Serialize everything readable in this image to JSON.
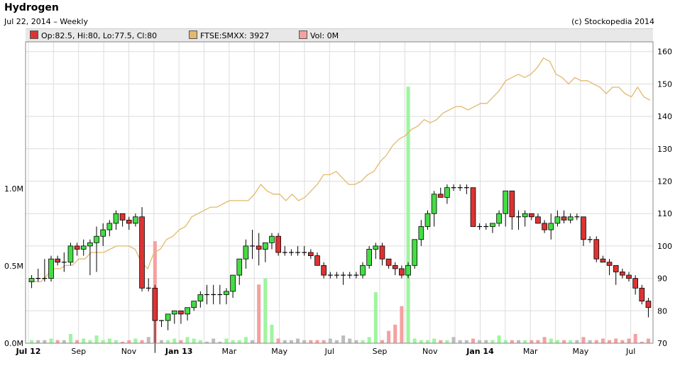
{
  "header": {
    "title": "Hydrogen",
    "subtitle": "Jul 22, 2014  –  Weekly",
    "copyright": "(c) Stockopedia 2014"
  },
  "legend": {
    "price": "Op:82.5, Hi:80, Lo:77.5, Cl:80",
    "index": "FTSE:SMXX: 3927",
    "volume": "Vol: 0M"
  },
  "colors": {
    "up": "#44dd44",
    "down": "#dd3333",
    "index_line": "#e2b96c",
    "vol_up": "#9ef59e",
    "vol_down": "#f5a0a0",
    "vol_neutral": "#bdbdbd",
    "grid": "#dddddd"
  },
  "chart_data": {
    "type": "candlestick",
    "x_labels": [
      "Jul 12",
      "Sep",
      "Nov",
      "Jan 13",
      "Mar",
      "May",
      "Jul",
      "Sep",
      "Nov",
      "Jan 14",
      "Mar",
      "May",
      "Jul"
    ],
    "x_label_bold": [
      true,
      false,
      false,
      true,
      false,
      false,
      false,
      false,
      false,
      true,
      false,
      false,
      false
    ],
    "price_axis": {
      "ticks": [
        70,
        80,
        90,
        100,
        110,
        120,
        130,
        140,
        150,
        160
      ],
      "range": [
        70,
        163
      ]
    },
    "volume_axis": {
      "ticks": [
        "0.0M",
        "0.5M",
        "1.0M"
      ],
      "tick_values": [
        0,
        0.5,
        1.0
      ],
      "range": [
        0,
        1.95
      ]
    },
    "candles": [
      [
        89,
        91,
        87,
        90
      ],
      [
        90,
        93,
        89,
        90
      ],
      [
        90,
        96,
        89,
        90
      ],
      [
        90,
        97,
        89,
        96
      ],
      [
        96,
        97,
        94,
        95
      ],
      [
        95,
        98,
        92,
        95
      ],
      [
        95,
        101,
        94,
        100
      ],
      [
        100,
        101,
        97,
        99
      ],
      [
        99,
        102,
        97,
        100
      ],
      [
        100,
        102,
        91,
        101
      ],
      [
        101,
        106,
        92,
        103
      ],
      [
        103,
        107,
        100,
        105
      ],
      [
        105,
        108,
        103,
        107
      ],
      [
        107,
        111,
        105,
        110
      ],
      [
        110,
        109,
        106,
        108
      ],
      [
        108,
        109,
        105,
        107
      ],
      [
        107,
        110,
        106,
        109
      ],
      [
        109,
        112,
        86,
        87
      ],
      [
        87,
        90,
        86,
        87
      ],
      [
        87,
        88,
        67,
        77
      ],
      [
        77,
        77,
        75,
        77
      ],
      [
        77,
        78,
        74,
        79
      ],
      [
        79,
        79,
        76,
        80
      ],
      [
        80,
        80,
        76,
        79
      ],
      [
        79,
        80,
        77,
        81
      ],
      [
        81,
        81,
        80,
        83
      ],
      [
        83,
        86,
        81,
        85
      ],
      [
        85,
        88,
        82,
        85
      ],
      [
        85,
        88,
        82,
        85
      ],
      [
        85,
        88,
        82,
        85
      ],
      [
        85,
        87,
        82,
        86
      ],
      [
        86,
        91,
        84,
        91
      ],
      [
        91,
        95,
        88,
        96
      ],
      [
        96,
        102,
        93,
        100
      ],
      [
        100,
        105,
        96,
        100
      ],
      [
        100,
        104,
        94,
        99
      ],
      [
        99,
        101,
        95,
        101
      ],
      [
        101,
        104,
        99,
        103
      ],
      [
        103,
        104,
        97,
        98
      ],
      [
        98,
        100,
        97,
        98
      ],
      [
        98,
        99,
        97,
        98
      ],
      [
        98,
        100,
        97,
        98
      ],
      [
        98,
        100,
        97,
        98
      ],
      [
        98,
        99,
        96,
        97
      ],
      [
        97,
        98,
        94,
        94
      ],
      [
        94,
        95,
        90,
        91
      ],
      [
        91,
        92,
        90,
        91
      ],
      [
        91,
        92,
        90,
        91
      ],
      [
        91,
        92,
        88,
        91
      ],
      [
        91,
        92,
        90,
        91
      ],
      [
        91,
        92,
        90,
        91
      ],
      [
        91,
        95,
        90,
        94
      ],
      [
        94,
        100,
        93,
        99
      ],
      [
        99,
        101,
        96,
        100
      ],
      [
        100,
        101,
        94,
        96
      ],
      [
        96,
        96,
        93,
        94
      ],
      [
        94,
        95,
        91,
        93
      ],
      [
        93,
        94,
        90,
        91
      ],
      [
        91,
        95,
        90,
        94
      ],
      [
        94,
        102,
        93,
        102
      ],
      [
        102,
        108,
        100,
        106
      ],
      [
        106,
        111,
        105,
        110
      ],
      [
        110,
        117,
        106,
        116
      ],
      [
        116,
        118,
        115,
        115
      ],
      [
        115,
        119,
        113,
        118
      ],
      [
        118,
        119,
        117,
        118
      ],
      [
        118,
        119,
        117,
        118
      ],
      [
        118,
        119,
        116,
        118
      ],
      [
        118,
        118,
        106,
        106
      ],
      [
        106,
        107,
        105,
        106
      ],
      [
        106,
        107,
        105,
        106
      ],
      [
        106,
        107,
        104,
        107
      ],
      [
        107,
        111,
        106,
        110
      ],
      [
        110,
        117,
        106,
        117
      ],
      [
        117,
        117,
        105,
        109
      ],
      [
        109,
        111,
        105,
        109
      ],
      [
        109,
        111,
        106,
        110
      ],
      [
        110,
        110,
        108,
        109
      ],
      [
        109,
        110,
        107,
        107
      ],
      [
        107,
        108,
        104,
        105
      ],
      [
        105,
        110,
        102,
        107
      ],
      [
        107,
        111,
        106,
        109
      ],
      [
        109,
        111,
        107,
        108
      ],
      [
        108,
        110,
        107,
        109
      ],
      [
        109,
        110,
        108,
        109
      ],
      [
        109,
        109,
        100,
        102
      ],
      [
        102,
        103,
        101,
        102
      ],
      [
        102,
        103,
        95,
        96
      ],
      [
        96,
        97,
        95,
        95
      ],
      [
        95,
        96,
        91,
        94
      ],
      [
        94,
        94,
        88,
        92
      ],
      [
        92,
        93,
        90,
        91
      ],
      [
        91,
        92,
        89,
        90
      ],
      [
        90,
        91,
        85,
        87
      ],
      [
        87,
        88,
        82,
        83
      ],
      [
        83,
        84,
        78,
        81
      ]
    ],
    "index_series": [
      89,
      89,
      89,
      91,
      93,
      93,
      94,
      94,
      96,
      96,
      98,
      98,
      98,
      99,
      100,
      100,
      100,
      99,
      95,
      93,
      98,
      99,
      102,
      103,
      105,
      106,
      109,
      110,
      111,
      112,
      112,
      113,
      114,
      114,
      114,
      114,
      116,
      119,
      117,
      116,
      116,
      114,
      116,
      114,
      115,
      117,
      119,
      122,
      122,
      123,
      121,
      119,
      119,
      120,
      122,
      123,
      126,
      128,
      131,
      133,
      134,
      136,
      137,
      139,
      138,
      139,
      141,
      142,
      143,
      143,
      142,
      143,
      144,
      144,
      146,
      148,
      151,
      152,
      153,
      152,
      153,
      155,
      158,
      157,
      153,
      152,
      150,
      152,
      151,
      151,
      150,
      149,
      147,
      149,
      149,
      147,
      146,
      149,
      146,
      145
    ],
    "volume": [
      0.02,
      0.02,
      0.02,
      0.03,
      0.02,
      0.02,
      0.06,
      0.02,
      0.03,
      0.02,
      0.05,
      0.02,
      0.03,
      0.02,
      0.01,
      0.02,
      0.03,
      0.02,
      0.04,
      0.66,
      0.02,
      0.02,
      0.03,
      0.02,
      0.04,
      0.03,
      0.02,
      0.01,
      0.03,
      0.01,
      0.03,
      0.02,
      0.02,
      0.04,
      0.02,
      0.38,
      0.42,
      0.12,
      0.03,
      0.02,
      0.02,
      0.03,
      0.02,
      0.02,
      0.02,
      0.02,
      0.03,
      0.02,
      0.05,
      0.03,
      0.02,
      0.02,
      0.04,
      0.33,
      0.02,
      0.08,
      0.12,
      0.24,
      1.66,
      0.03,
      0.02,
      0.02,
      0.03,
      0.02,
      0.02,
      0.04,
      0.02,
      0.02,
      0.03,
      0.02,
      0.02,
      0.02,
      0.05,
      0.02,
      0.02,
      0.02,
      0.02,
      0.02,
      0.02,
      0.04,
      0.03,
      0.02,
      0.02,
      0.02,
      0.02,
      0.04,
      0.02,
      0.02,
      0.03,
      0.02,
      0.03,
      0.02,
      0.03,
      0.06,
      0.01,
      0.03
    ]
  }
}
